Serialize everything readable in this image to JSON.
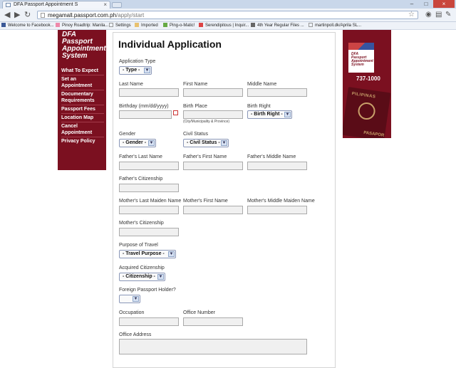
{
  "browser": {
    "tab_title": "DFA Passport Appointment S",
    "url_host": "megamall.passport.com.ph",
    "url_path": "/apply/start",
    "bookmarks": [
      "Welcome to Facebook...",
      "Pinoy Roadtrip: Manila...",
      "Settings",
      "Imported",
      "Ping-o-Matic!",
      "Serendipitous | Inquir...",
      "4th Year Regular Files ...",
      "martinpoll.dk/Aprila SL..."
    ]
  },
  "sidebar": {
    "logo": [
      "DFA Passport",
      "Appointment",
      "System"
    ],
    "menu": [
      "What To Expect",
      "Set an Appointment",
      "Documentary Requirements",
      "Passport Fees",
      "Location Map",
      "Cancel Appointment",
      "Privacy Policy"
    ]
  },
  "form": {
    "title": "Individual Application",
    "application_type_label": "Application Type",
    "application_type_value": "- Type -",
    "last_name": "Last Name",
    "first_name": "First Name",
    "middle_name": "Middle Name",
    "birthday": "Birthday (mm/dd/yyyy)",
    "birth_place": "Birth Place",
    "birth_place_hint": "(City/Municipality & Province)",
    "birth_right": "Birth Right",
    "birth_right_value": "- Birth Right -",
    "gender": "Gender",
    "gender_value": "- Gender -",
    "civil_status": "Civil Status",
    "civil_status_value": "- Civil Status -",
    "father_last": "Father's Last Name",
    "father_first": "Father's First Name",
    "father_middle": "Father's Middle Name",
    "father_citizenship": "Father's Citizenship",
    "mother_last": "Mother's Last Maiden Name",
    "mother_first": "Mother's First Name",
    "mother_middle": "Mother's Middle Maiden Name",
    "mother_citizenship": "Mother's Citizenship",
    "purpose": "Purpose of Travel",
    "purpose_value": "- Travel Purpose -",
    "acquired_citizenship": "Acquired Citizenship",
    "acquired_citizenship_value": "- Citizenship -",
    "foreign_passport": "Foreign Passport Holder?",
    "occupation": "Occupation",
    "office_number": "Office Number",
    "office_address": "Office Address"
  },
  "banner": {
    "logo": [
      "DFA Passport",
      "Appointment",
      "System"
    ],
    "phone": "737-1000",
    "passport_top": "PILIPINAS",
    "passport_bottom": "PASAPOR"
  }
}
